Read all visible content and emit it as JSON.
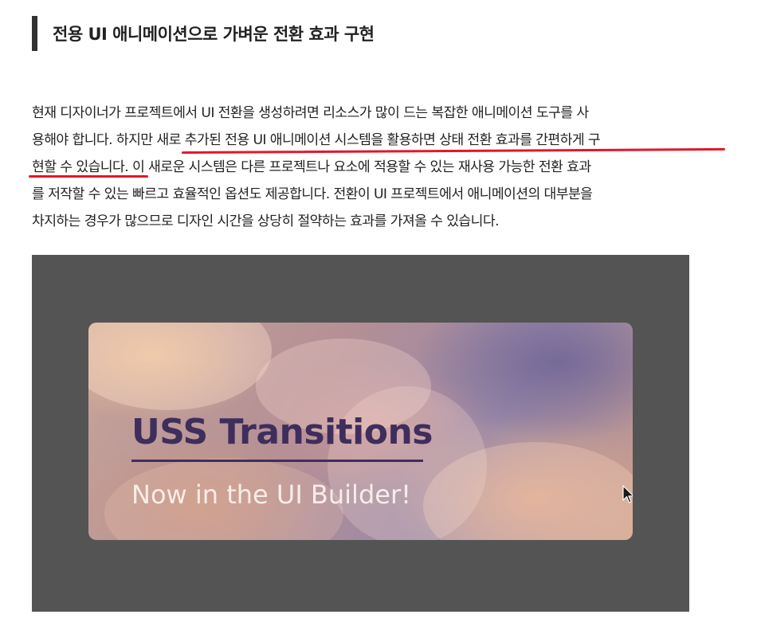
{
  "heading": {
    "title": "전용 UI 애니메이션으로 가벼운 전환 효과 구현"
  },
  "article": {
    "lines": [
      "현재 디자이너가 프로젝트에서 UI 전환을 생성하려면 리소스가 많이 드는 복잡한 애니메이션 도구를 사",
      "용해야 합니다. 하지만 새로 추가된 전용 UI 애니메이션 시스템을 활용하면 상태 전환 효과를 간편하게 구",
      "현할 수 있습니다. 이 새로운 시스템은 다른 프로젝트나 요소에 적용할 수 있는 재사용 가능한 전환 효과",
      "를 저작할 수 있는 빠르고 효율적인 옵션도 제공합니다. 전환이 UI 프로젝트에서 애니메이션의 대부분을",
      "차지하는 경우가 많으므로 디자인 시간을 상당히 절약하는 효과를 가져올 수 있습니다."
    ],
    "highlight_color": "#e4162a"
  },
  "media": {
    "banner_title": "USS Transitions",
    "banner_subtitle": "Now in the UI Builder!",
    "title_color": "#3f2e5c",
    "frame_color": "#545454"
  }
}
